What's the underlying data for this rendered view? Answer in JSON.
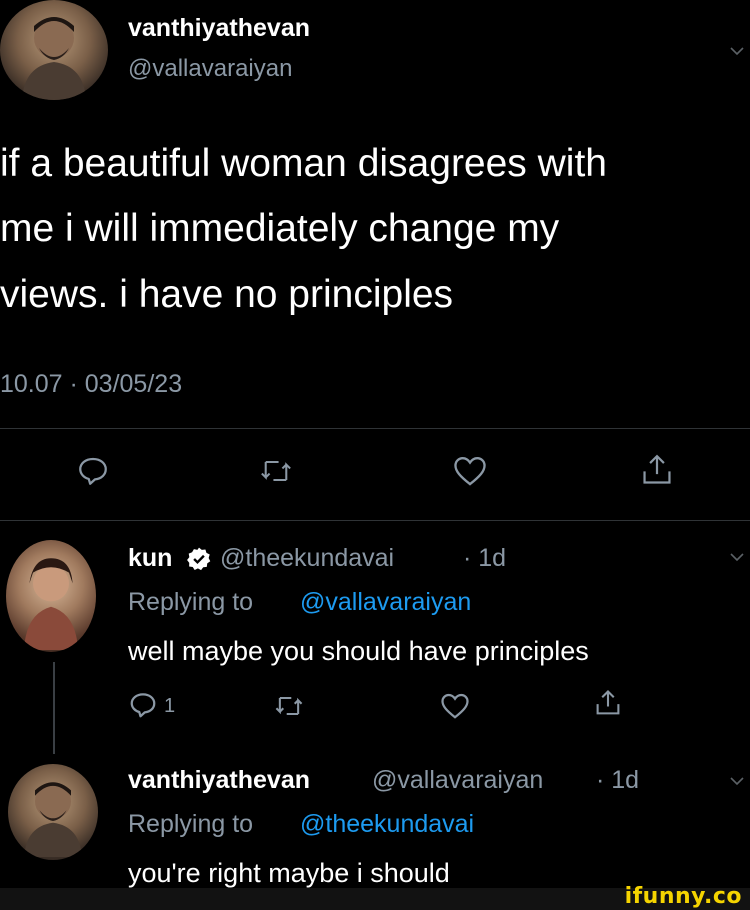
{
  "main_tweet": {
    "display_name": "vanthiyathevan",
    "handle": "@vallavaraiyan",
    "text_line1": "if a beautiful woman disagrees with",
    "text_line2": "me i will immediately change my",
    "text_line3": "views. i have no principles",
    "timestamp": "10.07 · 03/05/23"
  },
  "reply1": {
    "display_name": "kun",
    "handle": "@theekundavai",
    "age": "· 1d",
    "replying_to_prefix": "Replying to",
    "replying_to_handle": "@vallavaraiyan",
    "text": "well maybe you should have principles",
    "reply_count": "1"
  },
  "reply2": {
    "display_name": "vanthiyathevan",
    "handle": "@vallavaraiyan",
    "age": "· 1d",
    "replying_to_prefix": "Replying to",
    "replying_to_handle": "@theekundavai",
    "text": "you're right maybe i should"
  },
  "watermark": "ifunny.co",
  "colors": {
    "background": "#000000",
    "text": "#ffffff",
    "muted": "#8b98a5",
    "link": "#1d9bf0",
    "verified": "#ffffff",
    "watermark": "#f5d400"
  }
}
